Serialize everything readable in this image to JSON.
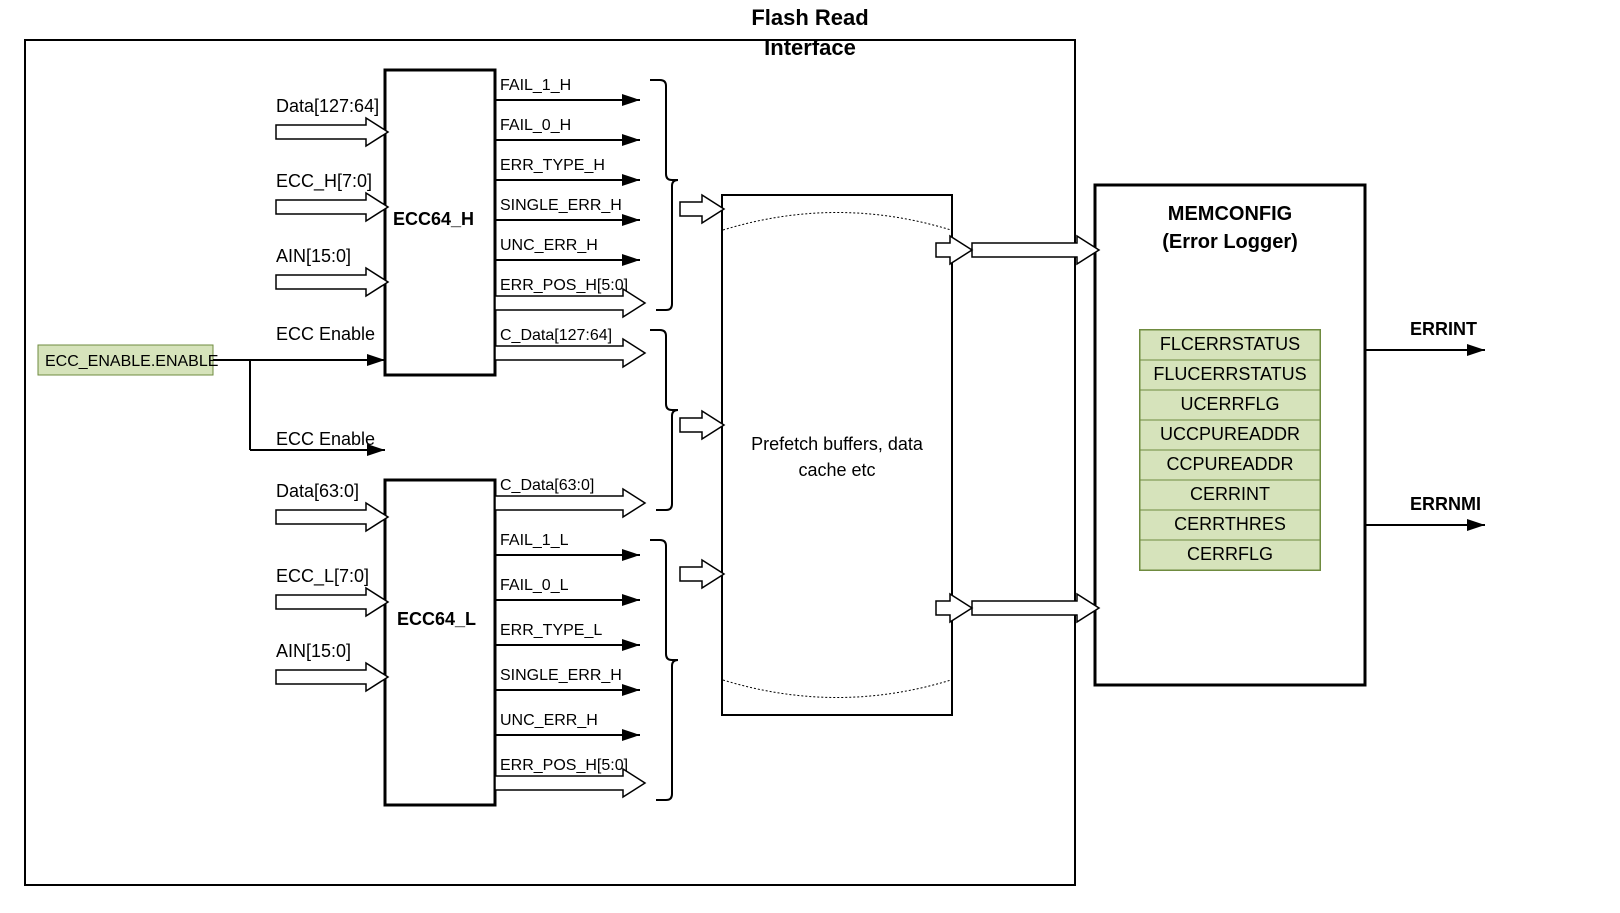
{
  "title": {
    "line1": "Flash Read",
    "line2": "Interface"
  },
  "eccEnableReg": "ECC_ENABLE.ENABLE",
  "eccEnableLabel": "ECC Enable",
  "ecc64H": {
    "name": "ECC64_H",
    "inputs": {
      "data": "Data[127:64]",
      "ecc": "ECC_H[7:0]",
      "ain": "AIN[15:0]"
    },
    "outputs": {
      "fail1": "FAIL_1_H",
      "fail0": "FAIL_0_H",
      "errType": "ERR_TYPE_H",
      "singleErr": "SINGLE_ERR_H",
      "uncErr": "UNC_ERR_H",
      "errPos": "ERR_POS_H[5:0]",
      "cdata": "C_Data[127:64]"
    }
  },
  "ecc64L": {
    "name": "ECC64_L",
    "inputs": {
      "data": "Data[63:0]",
      "ecc": "ECC_L[7:0]",
      "ain": "AIN[15:0]"
    },
    "outputs": {
      "fail1": "FAIL_1_L",
      "fail0": "FAIL_0_L",
      "errType": "ERR_TYPE_L",
      "singleErr": "SINGLE_ERR_H",
      "uncErr": "UNC_ERR_H",
      "errPos": "ERR_POS_H[5:0]",
      "cdata": "C_Data[63:0]"
    }
  },
  "prefetch": {
    "line1": "Prefetch buffers, data",
    "line2": "cache etc"
  },
  "memconfig": {
    "line1": "MEMCONFIG",
    "line2": "(Error Logger)",
    "regs": [
      "FLCERRSTATUS",
      "FLUCERRSTATUS",
      "UCERRFLG",
      "UCCPUREADDR",
      "CCPUREADDR",
      "CERRINT",
      "CERRTHRES",
      "CERRFLG"
    ],
    "outTop": "ERRINT",
    "outBot": "ERRNMI"
  }
}
